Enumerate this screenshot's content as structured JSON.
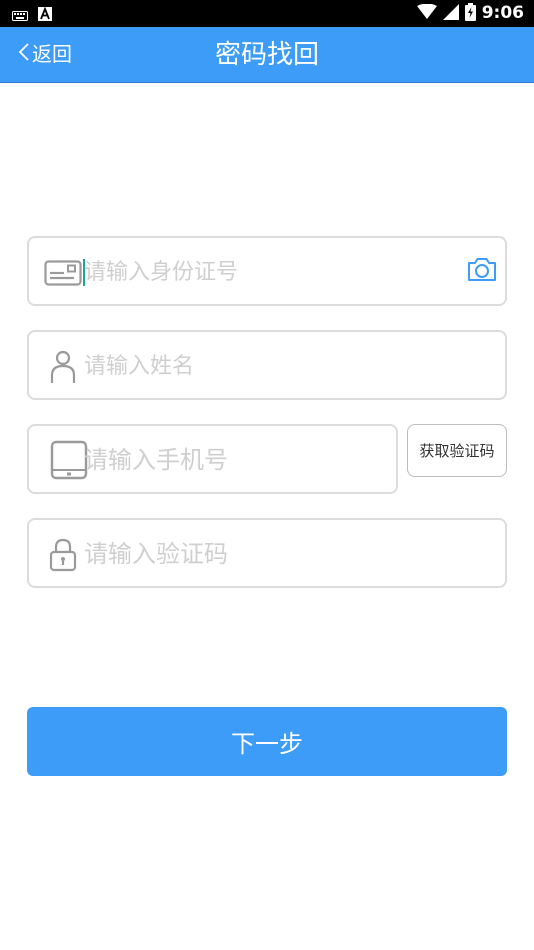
{
  "status_bar": {
    "time": "9:06",
    "icons": [
      "keyboard-icon",
      "a-notification-icon",
      "wifi-icon",
      "signal-icon",
      "battery-icon"
    ]
  },
  "header": {
    "back_label": "返回",
    "title": "密码找回"
  },
  "form": {
    "id_card": {
      "placeholder": "请输入身份证号",
      "value": "",
      "icon": "id-card-icon",
      "action_icon": "camera-icon"
    },
    "name": {
      "placeholder": "请输入姓名",
      "value": "",
      "icon": "person-icon"
    },
    "phone": {
      "placeholder": "请输入手机号",
      "value": "",
      "icon": "tablet-icon"
    },
    "get_code_label": "获取验证码",
    "code": {
      "placeholder": "请输入验证码",
      "value": "",
      "icon": "lock-icon"
    },
    "submit_label": "下一步"
  },
  "colors": {
    "accent": "#3d9cf7",
    "border": "#dcdcdc",
    "placeholder": "#cfcfcf",
    "cursor": "#1aa79a"
  }
}
